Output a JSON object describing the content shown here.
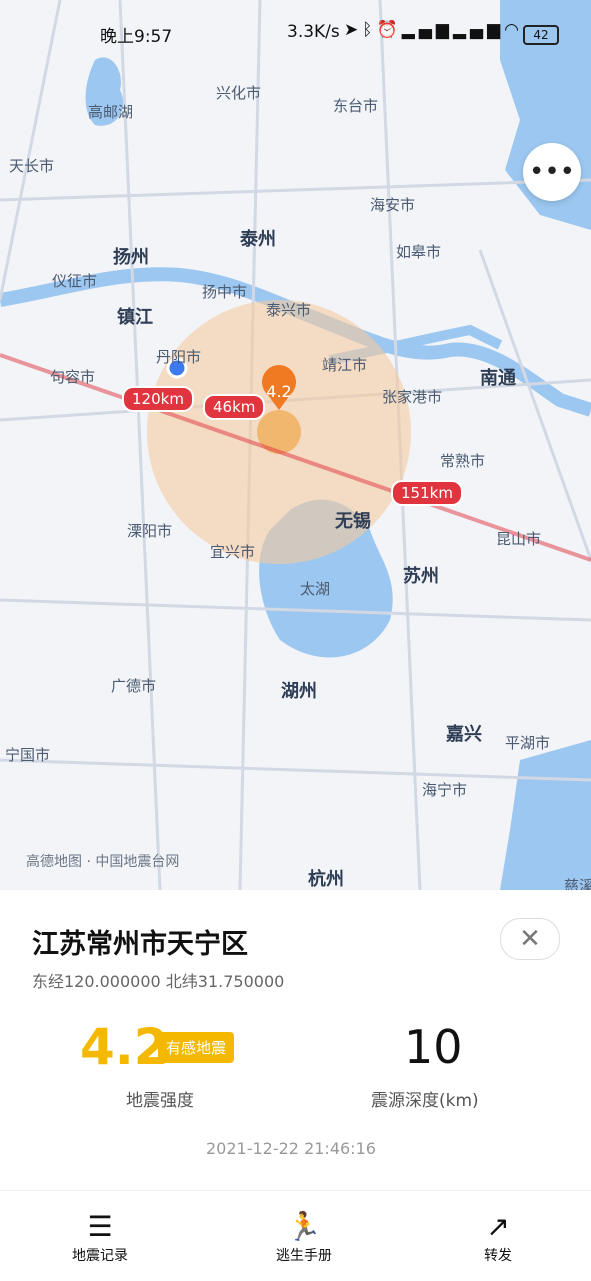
{
  "status_bar": {
    "time": "晚上9:57",
    "network_speed": "3.3K/s",
    "battery": "42",
    "icons": [
      "location-arrow",
      "bluetooth",
      "alarm",
      "signal-hd",
      "signal-hd",
      "wifi"
    ]
  },
  "map": {
    "cities": [
      {
        "name": "兴化市"
      },
      {
        "name": "东台市"
      },
      {
        "name": "高邮湖"
      },
      {
        "name": "天长市"
      },
      {
        "name": "海安市"
      },
      {
        "name": "泰州"
      },
      {
        "name": "扬州"
      },
      {
        "name": "仪征市"
      },
      {
        "name": "如皋市"
      },
      {
        "name": "扬中市"
      },
      {
        "name": "镇江"
      },
      {
        "name": "泰兴市"
      },
      {
        "name": "丹阳市"
      },
      {
        "name": "靖江市"
      },
      {
        "name": "南通"
      },
      {
        "name": "句容市"
      },
      {
        "name": "张家港市"
      },
      {
        "name": "常熟市"
      },
      {
        "name": "无锡"
      },
      {
        "name": "溧阳市"
      },
      {
        "name": "宜兴市"
      },
      {
        "name": "昆山市"
      },
      {
        "name": "苏州"
      },
      {
        "name": "太湖"
      },
      {
        "name": "广德市"
      },
      {
        "name": "湖州"
      },
      {
        "name": "嘉兴"
      },
      {
        "name": "平湖市"
      },
      {
        "name": "宁国市"
      },
      {
        "name": "海宁市"
      },
      {
        "name": "杭州"
      },
      {
        "name": "慈溪"
      }
    ],
    "distances": [
      "120km",
      "46km",
      "151km"
    ],
    "marker_label": "4.2",
    "credit": "高德地图 · 中国地震台网",
    "colors": {
      "radius": "#f5c9a0",
      "route": "#e0343e",
      "water": "#9cc7f0",
      "marker": "#f07a22"
    }
  },
  "more_button": {
    "icon": "more-dots-icon"
  },
  "detail": {
    "location": "江苏常州市天宁区",
    "coordinates": "东经120.000000 北纬31.750000",
    "magnitude": "4.2",
    "badge": "有感地震",
    "magnitude_label": "地震强度",
    "depth": "10",
    "depth_label": "震源深度(km)",
    "timestamp": "2021-12-22 21:46:16",
    "accent": "#f5b800"
  },
  "nav": [
    {
      "label": "地震记录",
      "icon": "list-icon"
    },
    {
      "label": "逃生手册",
      "icon": "runner-icon"
    },
    {
      "label": "转发",
      "icon": "share-icon"
    }
  ]
}
